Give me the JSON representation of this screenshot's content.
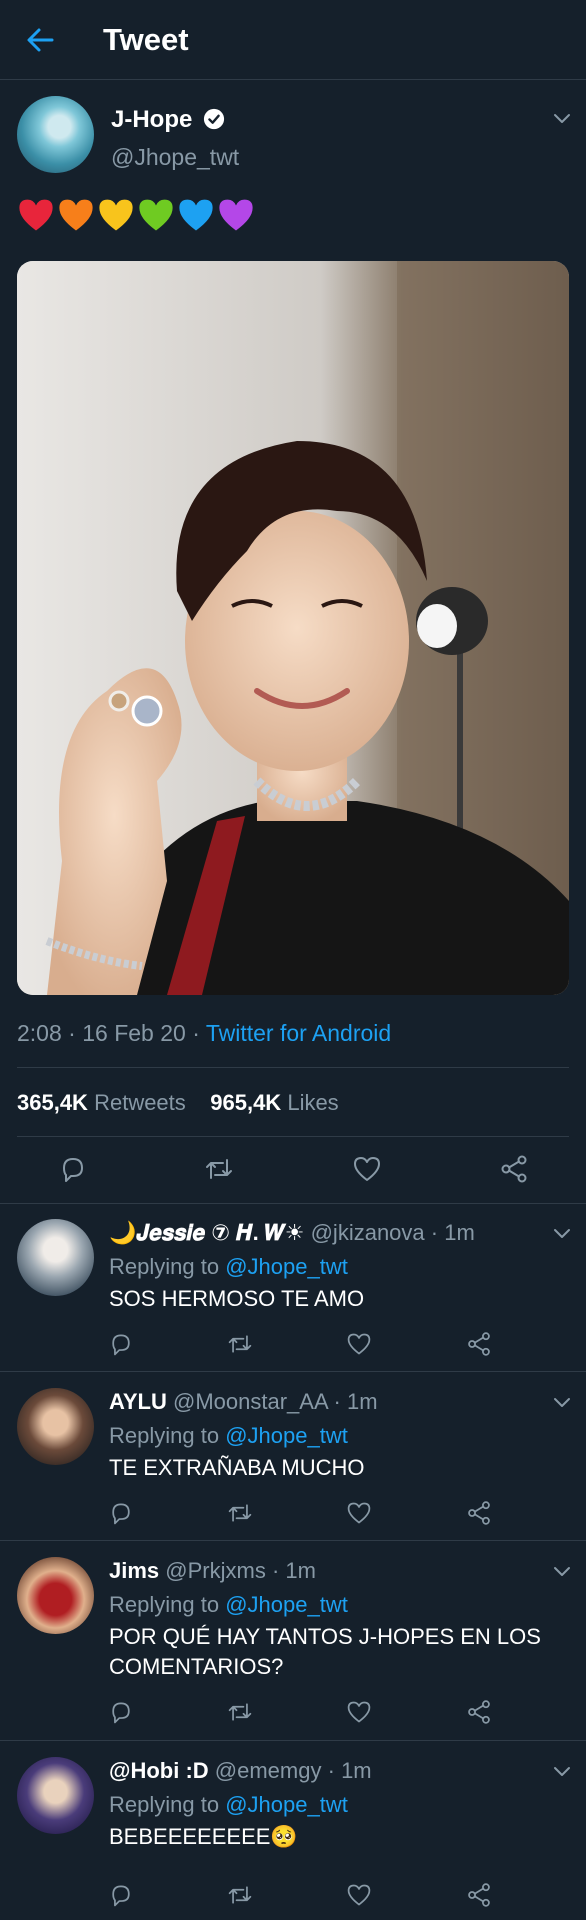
{
  "header": {
    "title": "Tweet"
  },
  "tweet": {
    "name": "J-Hope",
    "handle": "@Jhope_twt",
    "hearts": [
      "#e8253b",
      "#f77f1a",
      "#f8c41c",
      "#6fcb22",
      "#1da1f2",
      "#b447e8"
    ],
    "time": "2:08",
    "date": "16 Feb 20",
    "source": "Twitter for Android",
    "retweets_count": "365,4K",
    "retweets_label": "Retweets",
    "likes_count": "965,4K",
    "likes_label": "Likes"
  },
  "replies": [
    {
      "name": "🌙𝑱𝒆𝒔𝒔𝒊𝒆 ⑦ 𝑯. 𝑾☀",
      "handle": "@jkizanova",
      "time": "1m",
      "replying_label": "Replying to",
      "mention": "@Jhope_twt",
      "text": "SOS HERMOSO TE AMO"
    },
    {
      "name": "AYLU",
      "handle": "@Moonstar_AA",
      "time": "1m",
      "replying_label": "Replying to",
      "mention": "@Jhope_twt",
      "text": "TE EXTRAÑABA MUCHO"
    },
    {
      "name": "Jims",
      "handle": "@Prkjxms",
      "time": "1m",
      "replying_label": "Replying to",
      "mention": "@Jhope_twt",
      "text": "POR QUÉ HAY TANTOS J-HOPES EN LOS COMENTARIOS?"
    },
    {
      "name": "@Hobi :D",
      "handle": "@ememgy",
      "time": "1m",
      "replying_label": "Replying to",
      "mention": "@Jhope_twt",
      "text": "BEBEEEEEEEE🥺"
    }
  ],
  "colors": {
    "background": "#15202b",
    "accent": "#1da1f2",
    "muted": "#8899a6",
    "divider": "#2f3b47"
  },
  "icons": [
    "back-arrow-icon",
    "verified-badge-icon",
    "chevron-down-icon",
    "reply-icon",
    "retweet-icon",
    "like-icon",
    "share-icon"
  ]
}
